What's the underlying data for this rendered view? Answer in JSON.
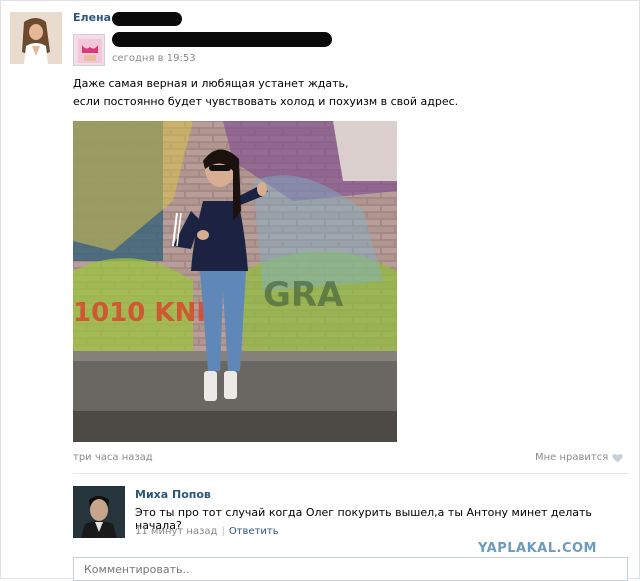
{
  "post": {
    "author_first_name": "Елена",
    "time": "сегодня в 19:53",
    "text_line1": "Даже самая верная и любящая устанет ждать,",
    "text_line2": "если постоянно будет чувствовать холод и похуизм в свой адрес.",
    "posted_ago": "три часа назад",
    "like_label": "Мне нравится"
  },
  "comment": {
    "author": "Миха Попов",
    "text": "Это ты про тот случай когда Олег покурить вышел,а ты Антону минет делать начала?",
    "time": "11 минут назад",
    "reply_label": "Ответить"
  },
  "composer": {
    "placeholder": "Комментировать.."
  },
  "watermark": "YAPLAKAL.COM",
  "colors": {
    "link": "#2b587a",
    "muted": "#8a8a8a",
    "border": "#c5d0db"
  }
}
